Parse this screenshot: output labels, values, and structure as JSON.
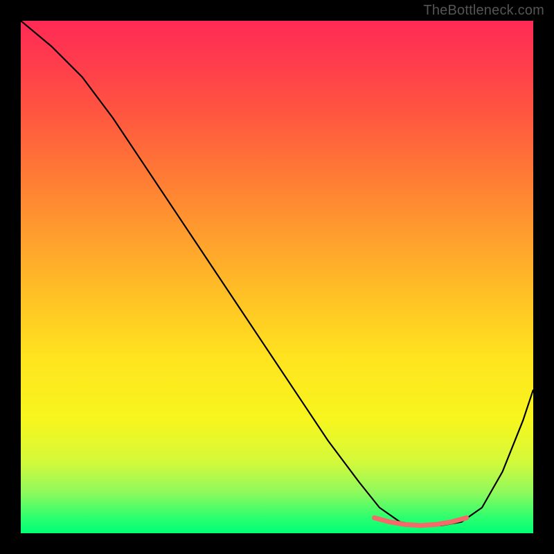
{
  "watermark": "TheBottleneck.com",
  "chart_data": {
    "type": "line",
    "title": "",
    "xlabel": "",
    "ylabel": "",
    "xlim": [
      0,
      100
    ],
    "ylim": [
      0,
      100
    ],
    "series": [
      {
        "name": "bottleneck-curve",
        "color": "#000000",
        "x": [
          0,
          6,
          12,
          18,
          24,
          30,
          36,
          42,
          48,
          54,
          60,
          66,
          70,
          74,
          78,
          82,
          86,
          90,
          94,
          98,
          100
        ],
        "values": [
          100,
          95,
          89,
          81,
          72,
          63,
          54,
          45,
          36,
          27,
          18,
          10,
          5,
          2.2,
          1.5,
          1.5,
          2.2,
          5,
          12,
          22,
          28
        ]
      },
      {
        "name": "highlight-band",
        "color": "#f26a6a",
        "x": [
          69,
          72,
          75,
          78,
          81,
          84,
          87
        ],
        "values": [
          3.0,
          2.2,
          1.7,
          1.5,
          1.7,
          2.2,
          3.0
        ]
      }
    ],
    "gradient_stops": [
      {
        "pos": 0.0,
        "color": "#ff2a55"
      },
      {
        "pos": 0.18,
        "color": "#ff5640"
      },
      {
        "pos": 0.42,
        "color": "#ff9e2e"
      },
      {
        "pos": 0.66,
        "color": "#ffe41f"
      },
      {
        "pos": 0.86,
        "color": "#d4f93a"
      },
      {
        "pos": 1.0,
        "color": "#00ff78"
      }
    ]
  }
}
